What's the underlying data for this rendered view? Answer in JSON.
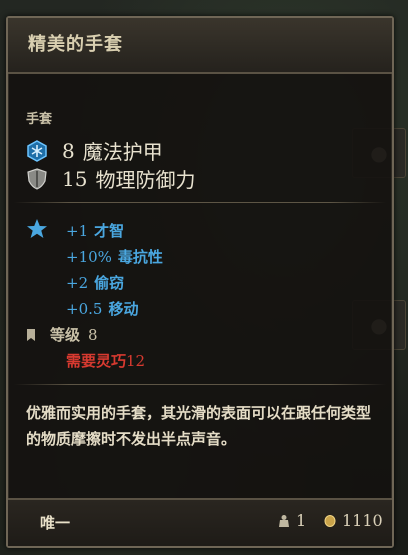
{
  "item": {
    "name": "精美的手套",
    "type": "手套",
    "stats": [
      {
        "value": "8",
        "label": "魔法护甲",
        "icon": "magic-armor-icon"
      },
      {
        "value": "15",
        "label": "物理防御力",
        "icon": "physical-armor-icon"
      }
    ],
    "bonuses": [
      {
        "value": "+1",
        "label": "才智"
      },
      {
        "value": "+10%",
        "label": "毒抗性"
      },
      {
        "value": "+2",
        "label": "偷窃"
      },
      {
        "value": "+0.5",
        "label": "移动"
      }
    ],
    "level": {
      "label": "等级",
      "value": "8"
    },
    "requirement": {
      "label": "需要灵巧",
      "value": "12"
    },
    "description": "优雅而实用的手套，其光滑的表面可以在跟任何类型的物质摩擦时不发出半点声音。",
    "rarity": "唯一",
    "weight": "1",
    "gold": "1110"
  },
  "colors": {
    "bonus": "#4aa7e0",
    "requirement": "#d83a30",
    "title": "#d9cfb0"
  }
}
